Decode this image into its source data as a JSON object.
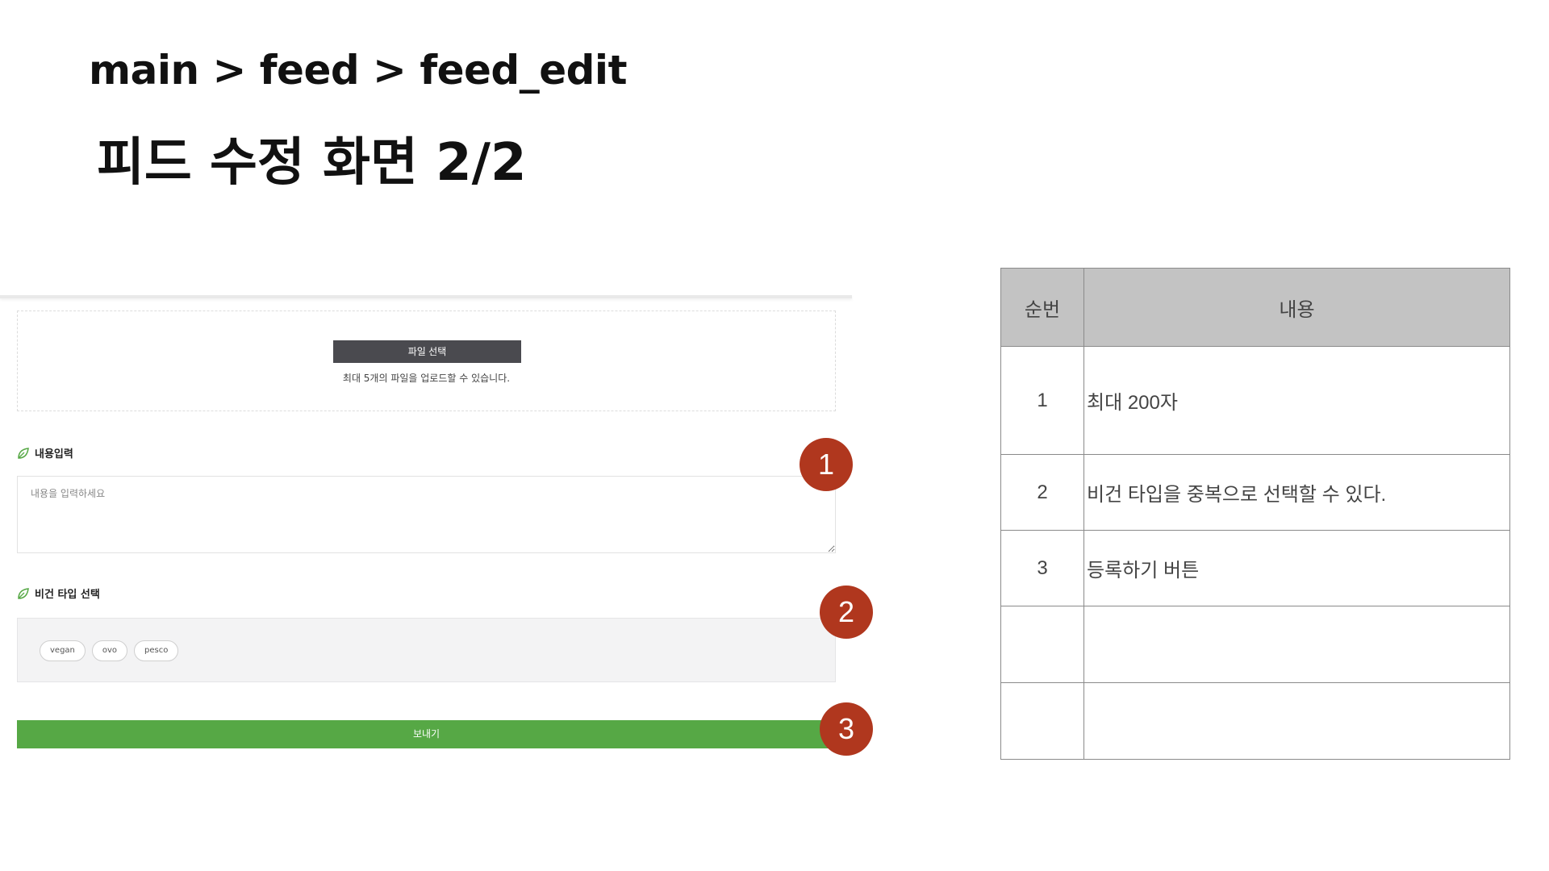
{
  "header": {
    "breadcrumb": "main > feed > feed_edit",
    "title": "피드 수정 화면 2/2"
  },
  "form": {
    "file_button_label": "파일 선택",
    "upload_hint": "최대 5개의 파일을 업로드할 수 있습니다.",
    "content_label": "내용입력",
    "content_placeholder": "내용을 입력하세요",
    "vegan_label": "비건 타입 선택",
    "vegan_options": [
      "vegan",
      "ovo",
      "pesco"
    ],
    "send_button_label": "보내기",
    "icon": "leaf-icon",
    "accent_color": "#56a845",
    "dark_button_color": "#4a4a4f"
  },
  "markers": [
    "1",
    "2",
    "3"
  ],
  "marker_color": "#b0371e",
  "spec_table": {
    "headers": [
      "순번",
      "내용"
    ],
    "rows": [
      {
        "num": "1",
        "desc": "최대 200자"
      },
      {
        "num": "2",
        "desc": "비건 타입을 중복으로 선택할 수 있다."
      },
      {
        "num": "3",
        "desc": "등록하기 버튼"
      },
      {
        "num": "",
        "desc": ""
      },
      {
        "num": "",
        "desc": ""
      }
    ],
    "header_bg": "#c3c3c3"
  }
}
